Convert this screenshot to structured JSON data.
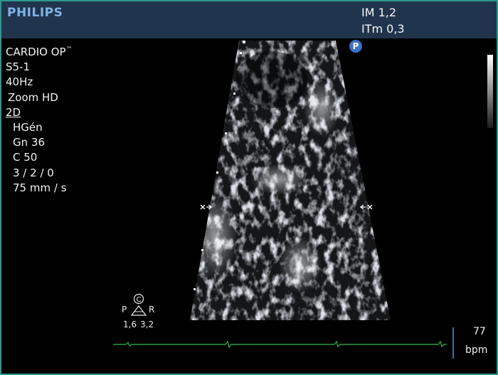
{
  "header": {
    "brand": "PHILIPS",
    "mi": "IM 1,2",
    "tis": "ITm 0,3"
  },
  "probe_badge": "P",
  "parameters": {
    "preset": "CARDIO OP",
    "preset_superscript": "™",
    "transducer": "S5-1",
    "frame_rate": "40Hz",
    "zoom": "Zoom HD",
    "mode": "2D",
    "harmonics": "HGén",
    "gain": "Gn 36",
    "compression": "C 50",
    "persistence": "3 / 2 / 0",
    "sweep_speed": "75 mm / s"
  },
  "orientation": {
    "left_label": "P",
    "right_label": "R",
    "center_symbol": "C",
    "left_value": "1,6",
    "right_value": "3,2"
  },
  "heart_rate": {
    "value": "77",
    "unit": "bpm"
  },
  "colors": {
    "header_bg": "#21344d",
    "brand": "#7fb4e6",
    "frame_border": "#2b9a8e",
    "ecg_trace": "#2f9a4a",
    "probe_badge": "#3b70c4"
  }
}
